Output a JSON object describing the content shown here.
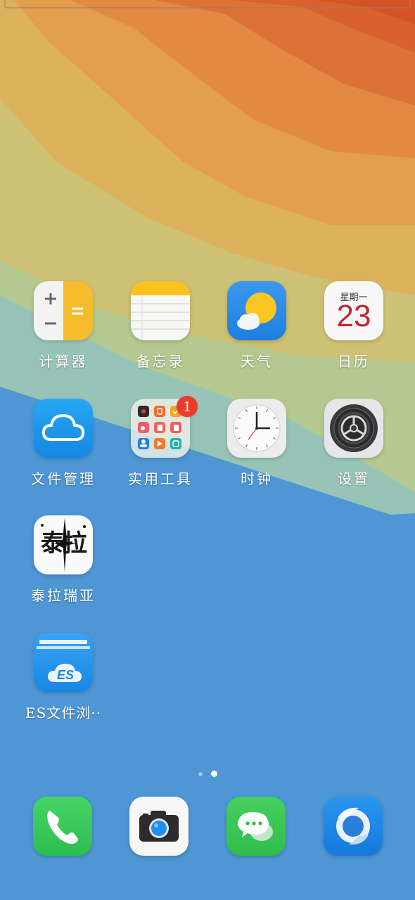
{
  "apps": [
    {
      "label": "计算器",
      "icon": "calculator-icon"
    },
    {
      "label": "备忘录",
      "icon": "notes-icon"
    },
    {
      "label": "天气",
      "icon": "weather-icon"
    },
    {
      "label": "日历",
      "icon": "calendar-icon",
      "weekday": "星期一",
      "day": "23"
    },
    {
      "label": "文件管理",
      "icon": "cloud-icon"
    },
    {
      "label": "实用工具",
      "icon": "folder-icon",
      "badge": "1"
    },
    {
      "label": "时钟",
      "icon": "clock-icon"
    },
    {
      "label": "设置",
      "icon": "gear-icon"
    },
    {
      "label": "泰拉瑞亚",
      "icon": "terraria-icon",
      "logo_text": "泰拉"
    },
    {
      "label": "ES文件浏··",
      "icon": "es-file-icon",
      "logo_text": "ES"
    }
  ],
  "dock": [
    {
      "icon": "phone-icon"
    },
    {
      "icon": "camera-icon"
    },
    {
      "icon": "messages-icon"
    },
    {
      "icon": "browser-icon"
    }
  ],
  "page_indicator": {
    "pages": 2,
    "current": 2
  },
  "colors": {
    "wallpaper_blue": "#4f96d4",
    "phone_green": "#35c759",
    "messages_green": "#3bc456",
    "weather_blue": "#2d8ae8",
    "browser_blue": "#1e88e5",
    "calendar_red": "#c0282e",
    "badge_red": "#ee3a2c"
  }
}
